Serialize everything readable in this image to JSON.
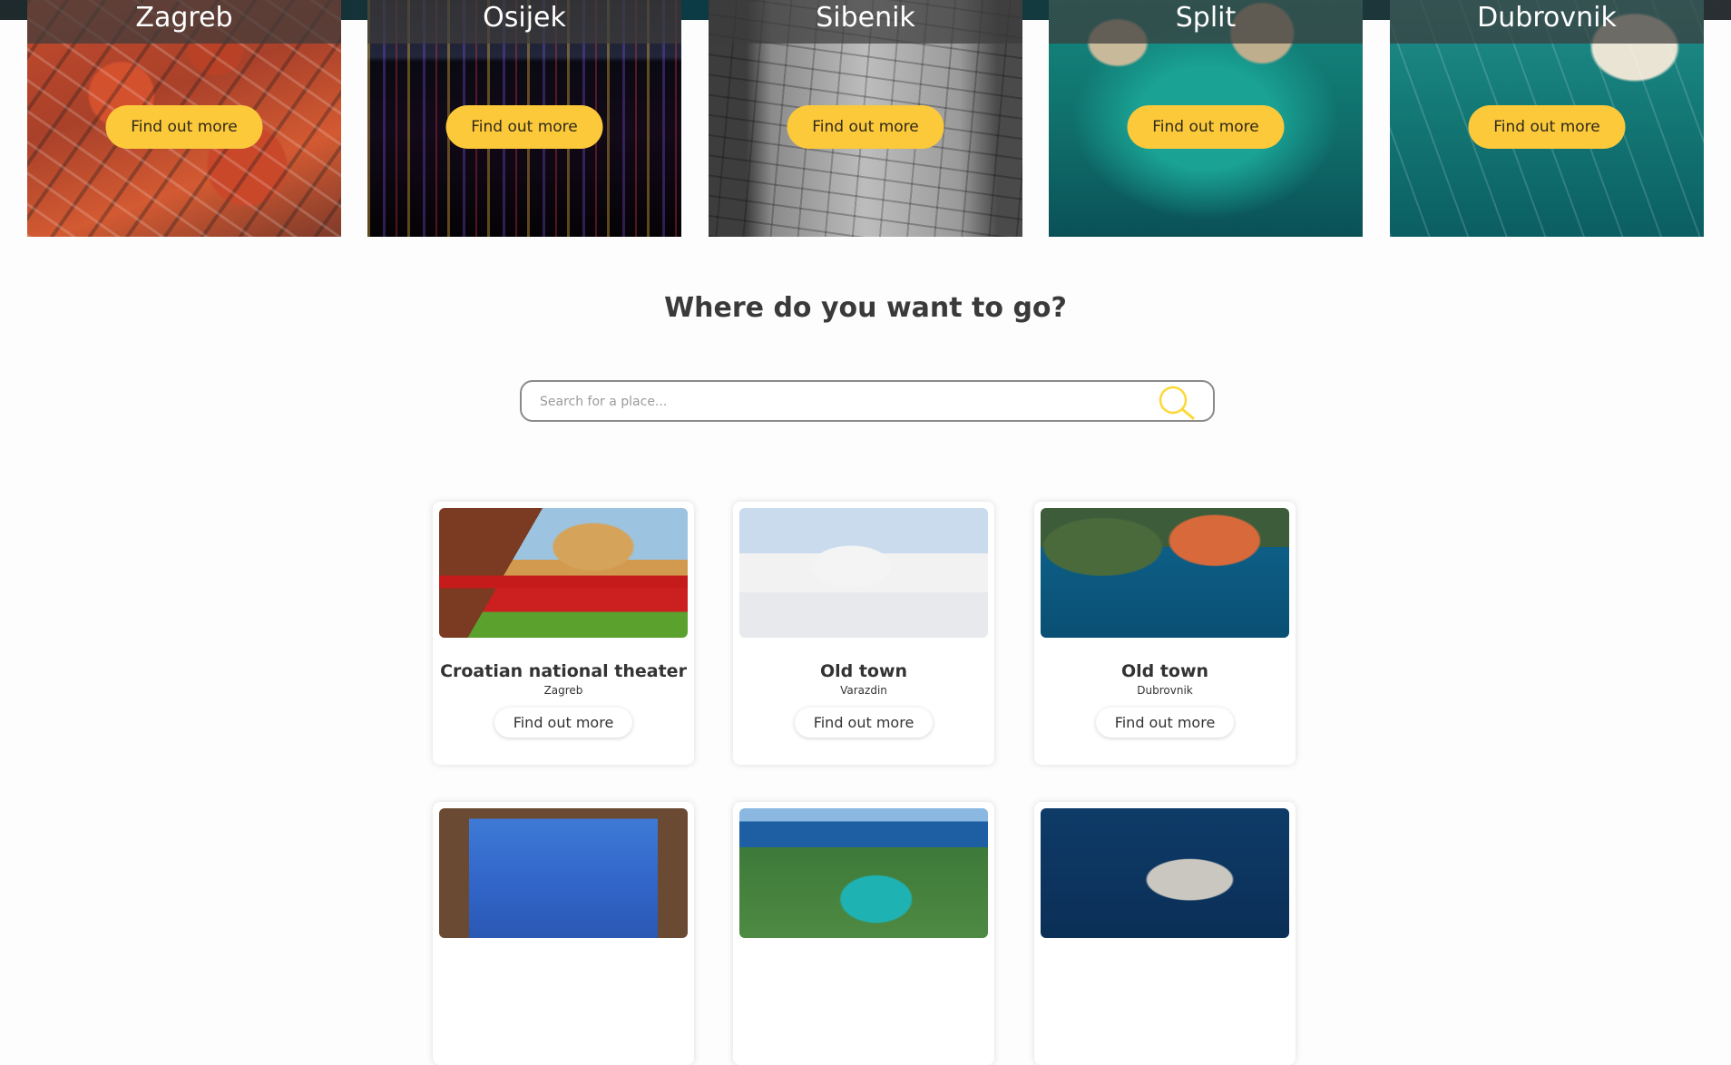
{
  "cities": [
    {
      "name": "Zagreb",
      "cta": "Find out more"
    },
    {
      "name": "Osijek",
      "cta": "Find out more"
    },
    {
      "name": "Sibenik",
      "cta": "Find out more"
    },
    {
      "name": "Split",
      "cta": "Find out more"
    },
    {
      "name": "Dubrovnik",
      "cta": "Find out more"
    }
  ],
  "heading": "Where do you want to go?",
  "search": {
    "placeholder": "Search for a place...",
    "value": "",
    "icon": "search-icon"
  },
  "places": [
    {
      "name": "Croatian national theater",
      "location": "Zagreb",
      "button": "Find out more"
    },
    {
      "name": "Old town",
      "location": "Varazdin",
      "button": "Find out more"
    },
    {
      "name": "Old town",
      "location": "Dubrovnik",
      "button": "Find out more"
    }
  ],
  "colors": {
    "accent": "#fcc93b",
    "text": "#333333",
    "background": "#fdfdfd"
  }
}
